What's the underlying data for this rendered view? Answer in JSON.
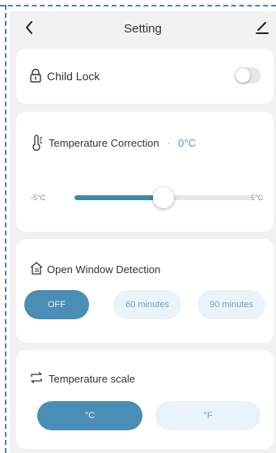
{
  "header": {
    "title": "Setting"
  },
  "child_lock": {
    "label": "Child Lock",
    "enabled": false
  },
  "temperature_correction": {
    "label": "Temperature Correction",
    "separator": "·",
    "value": "0°C",
    "min_label": "-5°C",
    "max_label": "5°C",
    "slider_fraction": 0.5
  },
  "open_window_detection": {
    "label": "Open Window Detection",
    "options": [
      "OFF",
      "60 minutes",
      "90 minutes"
    ],
    "selected": "OFF"
  },
  "temperature_scale": {
    "label": "Temperature scale",
    "options": [
      "°C",
      "°F"
    ],
    "selected": "°C"
  },
  "colors": {
    "accent": "#4a8db5",
    "value_text": "#4b9fc8",
    "inactive_pill": "#e9f3f9",
    "background": "#f1f1f3"
  }
}
